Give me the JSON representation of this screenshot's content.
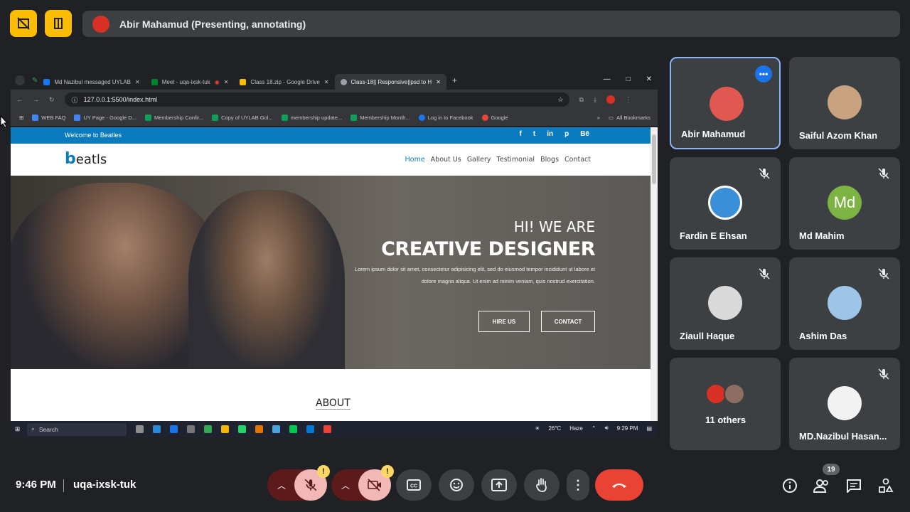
{
  "meet": {
    "presenter_banner": "Abir Mahamud (Presenting, annotating)",
    "clock": "9:46 PM",
    "meeting_code": "uqa-ixsk-tuk",
    "participant_badge": "19",
    "participants": [
      {
        "name": "Abir Mahamud",
        "avatar_text": "",
        "avatar_color": "#e0584f",
        "muted": false,
        "selected": true
      },
      {
        "name": "Saiful Azom Khan",
        "avatar_text": "",
        "avatar_color": "#c9a37f",
        "muted": false,
        "selected": false
      },
      {
        "name": "Fardin E Ehsan",
        "avatar_text": "",
        "avatar_color": "#3b8fd6",
        "muted": true,
        "selected": false
      },
      {
        "name": "Md Mahim",
        "avatar_text": "Md",
        "avatar_color": "#7cb342",
        "muted": true,
        "selected": false
      },
      {
        "name": "Ziaull Haque",
        "avatar_text": "",
        "avatar_color": "#d9d9d9",
        "muted": true,
        "selected": false
      },
      {
        "name": "Ashim Das",
        "avatar_text": "",
        "avatar_color": "#9ec5e8",
        "muted": true,
        "selected": false
      },
      {
        "name": "11 others",
        "avatar_text": "",
        "avatar_color": "#5f6368",
        "muted": false,
        "selected": false
      },
      {
        "name": "MD.Nazibul Hasan...",
        "avatar_text": "",
        "avatar_color": "#f2f2f2",
        "muted": true,
        "selected": false
      }
    ]
  },
  "browser": {
    "tabs": [
      {
        "label": "Md Nazibul messaged UYLAB",
        "color": "#1877f2"
      },
      {
        "label": "Meet - uqa-ixsk-tuk",
        "color": "#00832d"
      },
      {
        "label": "Class 18.zip - Google Drive",
        "color": "#fbbc04"
      },
      {
        "label": "Class-18|| Responsive||psd to H",
        "color": "#9aa0a6"
      }
    ],
    "url": "127.0.0.1:5500/index.html",
    "bookmarks": [
      {
        "label": "WEB FAQ",
        "color": "#4285f4"
      },
      {
        "label": "UY Page - Google D...",
        "color": "#4285f4"
      },
      {
        "label": "Membership Confir...",
        "color": "#0f9d58"
      },
      {
        "label": "Copy of UYLAB Gol...",
        "color": "#0f9d58"
      },
      {
        "label": "membership update...",
        "color": "#0f9d58"
      },
      {
        "label": "Membership Month...",
        "color": "#0f9d58"
      },
      {
        "label": "Log in to Facebook",
        "color": "#1877f2"
      },
      {
        "label": "Google",
        "color": "#ea4335"
      }
    ],
    "all_bookmarks": "All Bookmarks"
  },
  "site": {
    "welcome": "Welcome to Beatles",
    "social": [
      "f",
      "t",
      "in",
      "p",
      "Bē"
    ],
    "logo_b": "b",
    "logo_rest": "eatls",
    "nav": [
      "Home",
      "About Us",
      "Gallery",
      "Testimonial",
      "Blogs",
      "Contact"
    ],
    "hero_sub": "HI! WE ARE",
    "hero_title": "CREATIVE DESIGNER",
    "hero_body": "Lorem ipsum dolor sit amet, consectetur adipisicing elit, sed do eiusmod tempor incididunt ut labore et dolore magna aliqua. Ut enim ad minim veniam, quis nostrud exercitation.",
    "btn_hire": "HIRE US",
    "btn_contact": "CONTACT",
    "about": "ABOUT"
  },
  "taskbar": {
    "search": "Search",
    "weather": "26°C",
    "weather_desc": "Haze",
    "time": "9:29 PM"
  }
}
